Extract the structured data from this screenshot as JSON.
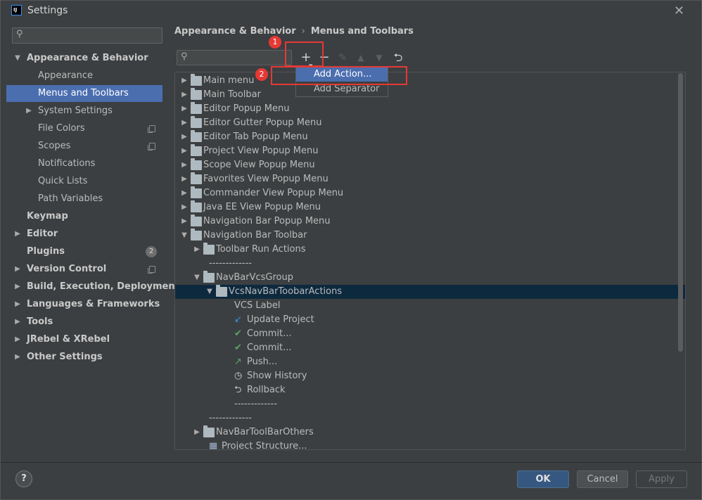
{
  "window": {
    "title": "Settings",
    "app_icon_text": "IJ"
  },
  "sidebar": {
    "search_placeholder": "",
    "items": [
      {
        "label": "Appearance & Behavior",
        "level": 0,
        "expanded": true,
        "bold": true
      },
      {
        "label": "Appearance",
        "level": 1
      },
      {
        "label": "Menus and Toolbars",
        "level": 1,
        "selected": true
      },
      {
        "label": "System Settings",
        "level": 1,
        "collapsed": true
      },
      {
        "label": "File Colors",
        "level": 1,
        "copy_icon": true
      },
      {
        "label": "Scopes",
        "level": 1,
        "copy_icon": true
      },
      {
        "label": "Notifications",
        "level": 1
      },
      {
        "label": "Quick Lists",
        "level": 1
      },
      {
        "label": "Path Variables",
        "level": 1
      },
      {
        "label": "Keymap",
        "level": 0,
        "bold": true
      },
      {
        "label": "Editor",
        "level": 0,
        "bold": true,
        "collapsed": true
      },
      {
        "label": "Plugins",
        "level": 0,
        "bold": true,
        "badge": "2"
      },
      {
        "label": "Version Control",
        "level": 0,
        "bold": true,
        "collapsed": true,
        "copy_icon": true
      },
      {
        "label": "Build, Execution, Deployment",
        "level": 0,
        "bold": true,
        "collapsed": true
      },
      {
        "label": "Languages & Frameworks",
        "level": 0,
        "bold": true,
        "collapsed": true
      },
      {
        "label": "Tools",
        "level": 0,
        "bold": true,
        "collapsed": true
      },
      {
        "label": "JRebel & XRebel",
        "level": 0,
        "bold": true,
        "collapsed": true
      },
      {
        "label": "Other Settings",
        "level": 0,
        "bold": true,
        "collapsed": true
      }
    ]
  },
  "breadcrumb": {
    "parent": "Appearance & Behavior",
    "separator": "›",
    "current": "Menus and Toolbars"
  },
  "toolbar": {
    "icons": [
      "add-icon",
      "remove-icon",
      "edit-icon",
      "move-up-icon",
      "move-down-icon",
      "restore-icon"
    ]
  },
  "annotations": {
    "step1": "1",
    "step2": "2"
  },
  "popup": {
    "items": [
      "Add Action...",
      "Add Separator"
    ]
  },
  "tree": {
    "rows": [
      {
        "label": "Main menu",
        "depth": 0,
        "toggle": "collapsed",
        "icon": "folder"
      },
      {
        "label": "Main Toolbar",
        "depth": 0,
        "toggle": "collapsed",
        "icon": "folder"
      },
      {
        "label": "Editor Popup Menu",
        "depth": 0,
        "toggle": "collapsed",
        "icon": "folder"
      },
      {
        "label": "Editor Gutter Popup Menu",
        "depth": 0,
        "toggle": "collapsed",
        "icon": "folder"
      },
      {
        "label": "Editor Tab Popup Menu",
        "depth": 0,
        "toggle": "collapsed",
        "icon": "folder"
      },
      {
        "label": "Project View Popup Menu",
        "depth": 0,
        "toggle": "collapsed",
        "icon": "folder"
      },
      {
        "label": "Scope View Popup Menu",
        "depth": 0,
        "toggle": "collapsed",
        "icon": "folder"
      },
      {
        "label": "Favorites View Popup Menu",
        "depth": 0,
        "toggle": "collapsed",
        "icon": "folder"
      },
      {
        "label": "Commander View Popup Menu",
        "depth": 0,
        "toggle": "collapsed",
        "icon": "folder"
      },
      {
        "label": "Java EE View Popup Menu",
        "depth": 0,
        "toggle": "collapsed",
        "icon": "folder"
      },
      {
        "label": "Navigation Bar Popup Menu",
        "depth": 0,
        "toggle": "collapsed",
        "icon": "folder"
      },
      {
        "label": "Navigation Bar Toolbar",
        "depth": 0,
        "toggle": "expanded",
        "icon": "folder"
      },
      {
        "label": "Toolbar Run Actions",
        "depth": 1,
        "toggle": "collapsed",
        "icon": "folder"
      },
      {
        "label": "-------------",
        "depth": 1,
        "toggle": "none",
        "icon": "none"
      },
      {
        "label": "NavBarVcsGroup",
        "depth": 1,
        "toggle": "expanded",
        "icon": "folder"
      },
      {
        "label": "VcsNavBarToobarActions",
        "depth": 2,
        "toggle": "expanded",
        "icon": "folder",
        "selected": true
      },
      {
        "label": "VCS Label",
        "depth": 3,
        "toggle": "none",
        "icon": "none"
      },
      {
        "label": "Update Project",
        "depth": 3,
        "toggle": "none",
        "icon": "update"
      },
      {
        "label": "Commit...",
        "depth": 3,
        "toggle": "none",
        "icon": "check"
      },
      {
        "label": "Commit...",
        "depth": 3,
        "toggle": "none",
        "icon": "check"
      },
      {
        "label": "Push...",
        "depth": 3,
        "toggle": "none",
        "icon": "push"
      },
      {
        "label": "Show History",
        "depth": 3,
        "toggle": "none",
        "icon": "history"
      },
      {
        "label": "Rollback",
        "depth": 3,
        "toggle": "none",
        "icon": "rollback"
      },
      {
        "label": "-------------",
        "depth": 3,
        "toggle": "none",
        "icon": "none"
      },
      {
        "label": "-------------",
        "depth": 1,
        "toggle": "none",
        "icon": "none"
      },
      {
        "label": "NavBarToolBarOthers",
        "depth": 1,
        "toggle": "collapsed",
        "icon": "folder"
      },
      {
        "label": "Project Structure...",
        "depth": 1,
        "toggle": "none",
        "icon": "structure"
      }
    ]
  },
  "footer": {
    "help": "?",
    "ok": "OK",
    "cancel": "Cancel",
    "apply": "Apply"
  },
  "colors": {
    "accent": "#4b6eaf",
    "selection_dark": "#0d293e",
    "annotation_red": "#e53935",
    "ok_button": "#365880"
  }
}
